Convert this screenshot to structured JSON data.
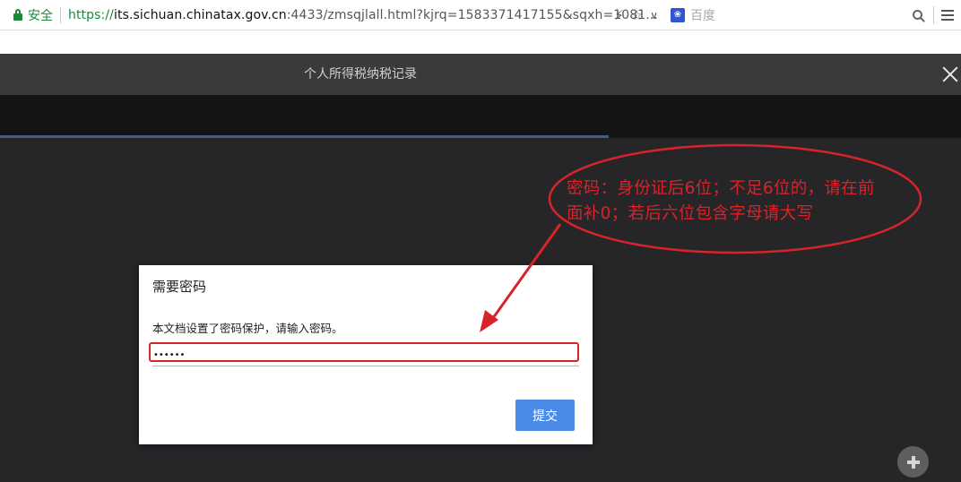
{
  "browser": {
    "secure_label": "安全",
    "url_scheme": "https://",
    "url_host": "its.sichuan.chinatax.gov.cn",
    "url_rest": ":4433/zmsqjlall.html?kjrq=1583371417155&sqxh=1081...",
    "search_engine_label": "百度",
    "icons": [
      "lock-icon",
      "lightning-icon",
      "star-icon",
      "chevron-down-icon",
      "baidu-paw-icon",
      "search-icon",
      "menu-icon"
    ]
  },
  "viewer": {
    "title": "个人所得税纳税记录",
    "progress_fraction": 0.633
  },
  "dialog": {
    "title": "需要密码",
    "message": "本文档设置了密码保护，请输入密码。",
    "password_value": "••••••",
    "submit_label": "提交"
  },
  "annotation": {
    "line1": "密码：身份证后6位；不足6位的，请在前",
    "line2": "面补0；若后六位包含字母请大写",
    "color": "#d8232a"
  },
  "colors": {
    "secure_green": "#1a8a3a",
    "submit_blue": "#4a8be8",
    "viewer_bg": "#262629"
  }
}
